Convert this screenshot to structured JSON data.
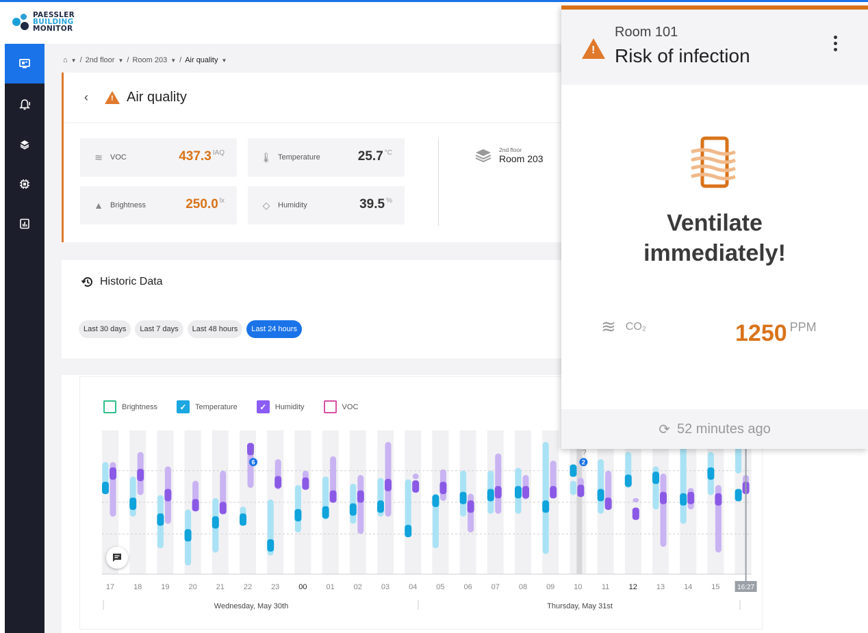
{
  "brand": {
    "line1": "PAESSLER",
    "line2": "BUILDING",
    "line3": "MONITOR"
  },
  "sidebar": {
    "items": [
      {
        "name": "dashboard",
        "icon": "monitor-icon",
        "active": true
      },
      {
        "name": "alerts",
        "icon": "bell-icon",
        "active": false
      },
      {
        "name": "layers",
        "icon": "layers-icon",
        "active": false
      },
      {
        "name": "devices",
        "icon": "chip-icon",
        "active": false
      },
      {
        "name": "reports",
        "icon": "report-icon",
        "active": false
      }
    ]
  },
  "breadcrumb": {
    "home_icon": "home-icon",
    "items": [
      "2nd floor",
      "Room 203",
      "Air quality"
    ],
    "separator": "/"
  },
  "header": {
    "title": "Air quality",
    "status_color": "#e0792b"
  },
  "sensors": [
    {
      "label": "VOC",
      "value": "437.3",
      "unit": "IAQ",
      "icon": "air-icon",
      "highlight": true
    },
    {
      "label": "Temperature",
      "value": "25.7",
      "unit": "°C",
      "icon": "thermometer-icon",
      "highlight": false
    },
    {
      "label": "Brightness",
      "value": "250.0",
      "unit": "lx",
      "icon": "lamp-icon",
      "highlight": true
    },
    {
      "label": "Humidity",
      "value": "39.5",
      "unit": "%",
      "icon": "droplet-icon",
      "highlight": false
    }
  ],
  "location": {
    "floor": "2nd floor",
    "room": "Room 203"
  },
  "historic": {
    "title": "Historic Data",
    "ranges": [
      {
        "label": "Last 30 days",
        "active": false
      },
      {
        "label": "Last 7 days",
        "active": false
      },
      {
        "label": "Last 48 hours",
        "active": false
      },
      {
        "label": "Last 24 hours",
        "active": true
      }
    ]
  },
  "chart_data": {
    "type": "bar",
    "legend": [
      {
        "name": "Brightness",
        "checked": false,
        "color": "#2fbf8a"
      },
      {
        "name": "Temperature",
        "checked": true,
        "color": "#1ba7e0"
      },
      {
        "name": "Humidity",
        "checked": true,
        "color": "#8b5cf6"
      },
      {
        "name": "VOC",
        "checked": false,
        "color": "#d94fa3"
      }
    ],
    "categories": [
      "17",
      "18",
      "19",
      "20",
      "21",
      "22",
      "23",
      "00",
      "01",
      "02",
      "03",
      "04",
      "05",
      "06",
      "07",
      "08",
      "09",
      "10",
      "11",
      "12",
      "13",
      "14",
      "15",
      "16:27"
    ],
    "bold_categories": [
      "00",
      "12"
    ],
    "series": [
      {
        "name": "Temperature",
        "low": [
          0.62,
          0.4,
          0.18,
          0.06,
          0.15,
          0.35,
          0.13,
          0.29,
          0.38,
          0.35,
          0.4,
          0.27,
          0.18,
          0.4,
          0.42,
          0.42,
          0.14,
          0.55,
          0.42,
          0.6,
          0.45,
          0.35,
          0.55,
          0.7
        ],
        "high": [
          0.78,
          0.68,
          0.55,
          0.45,
          0.53,
          0.47,
          0.52,
          0.62,
          0.68,
          0.63,
          0.67,
          0.66,
          0.56,
          0.72,
          0.72,
          0.74,
          0.92,
          0.65,
          0.8,
          0.85,
          0.75,
          0.95,
          0.85,
          0.94
        ],
        "mean": [
          0.6,
          0.49,
          0.38,
          0.27,
          0.36,
          0.38,
          0.2,
          0.41,
          0.43,
          0.45,
          0.47,
          0.3,
          0.51,
          0.53,
          0.55,
          0.57,
          0.47,
          0.72,
          0.55,
          0.65,
          0.67,
          0.52,
          0.7,
          0.55
        ]
      },
      {
        "name": "Humidity",
        "low": [
          0.4,
          0.55,
          0.35,
          0.45,
          0.42,
          0.6,
          0.59,
          0.65,
          0.5,
          0.28,
          0.4,
          0.66,
          0.51,
          0.29,
          0.42,
          0.52,
          0.55,
          0.6,
          0.48,
          0.5,
          0.19,
          0.45,
          0.15,
          0.6
        ],
        "high": [
          0.78,
          0.85,
          0.75,
          0.65,
          0.72,
          0.91,
          0.8,
          0.72,
          0.82,
          0.69,
          0.92,
          0.7,
          0.73,
          0.56,
          0.84,
          0.69,
          0.79,
          0.67,
          0.72,
          0.53,
          0.7,
          0.6,
          0.62,
          0.69
        ],
        "mean": [
          0.7,
          0.69,
          0.55,
          0.48,
          0.46,
          0.87,
          0.64,
          0.63,
          0.54,
          0.54,
          0.62,
          0.61,
          0.6,
          0.47,
          0.57,
          0.57,
          0.57,
          0.58,
          0.49,
          0.42,
          0.53,
          0.53,
          0.52,
          0.6
        ]
      }
    ],
    "markers": [
      {
        "category": "22",
        "label": "!",
        "badge": "6"
      },
      {
        "category": "10",
        "label": "?",
        "badge": "2"
      }
    ],
    "date_labels": [
      "Wednesday, May 30th",
      "Thursday, May 31st"
    ],
    "grid": true
  },
  "popup": {
    "room": "Room 101",
    "title": "Risk of infection",
    "message_line1": "Ventilate",
    "message_line2": "immediately!",
    "sensor_label": "CO₂",
    "sensor_value": "1250",
    "sensor_unit": "PPM",
    "updated": "52 minutes ago",
    "accent": "#d9731a"
  }
}
